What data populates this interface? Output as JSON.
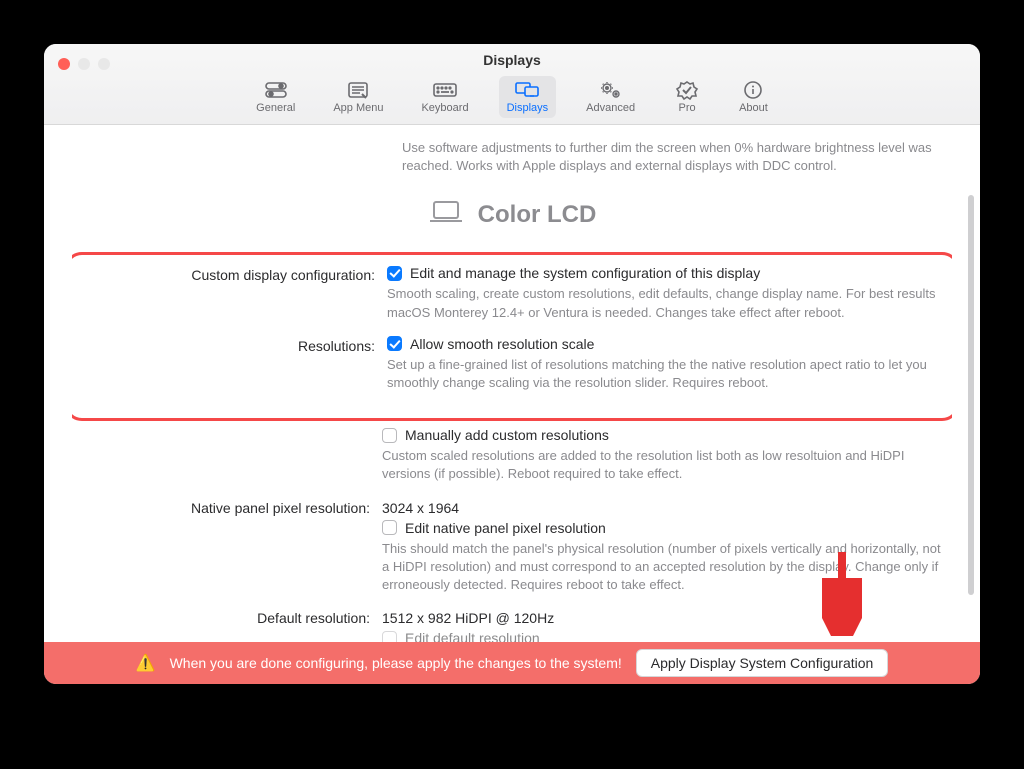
{
  "window": {
    "title": "Displays"
  },
  "toolbar": {
    "items": [
      {
        "key": "general",
        "label": "General"
      },
      {
        "key": "appmenu",
        "label": "App Menu"
      },
      {
        "key": "keyboard",
        "label": "Keyboard"
      },
      {
        "key": "displays",
        "label": "Displays"
      },
      {
        "key": "advanced",
        "label": "Advanced"
      },
      {
        "key": "pro",
        "label": "Pro"
      },
      {
        "key": "about",
        "label": "About"
      }
    ],
    "selected": "displays"
  },
  "intro": "Use software adjustments to further dim the screen when 0% hardware brightness level was reached. Works with Apple displays and external displays with DDC control.",
  "display_name": "Color LCD",
  "rows": {
    "custom_config": {
      "label": "Custom display configuration:",
      "checkbox_label": "Edit and manage the system configuration of this display",
      "checked": true,
      "desc": "Smooth scaling, create custom resolutions, edit defaults, change display name. For best results macOS Monterey 12.4+ or Ventura is needed. Changes take effect after reboot."
    },
    "resolutions": {
      "label": "Resolutions:",
      "checkbox_label": "Allow smooth resolution scale",
      "checked": true,
      "desc": "Set up a fine-grained list of resolutions matching the the native resolution apect ratio to let you smoothly change scaling via the resolution slider. Requires reboot."
    },
    "manual_add": {
      "checkbox_label": "Manually add custom resolutions",
      "checked": false,
      "desc": "Custom scaled resolutions are added to the resolution list both as low resoltuion and HiDPI versions (if possible). Reboot required to take effect."
    },
    "native_panel": {
      "label": "Native panel pixel resolution:",
      "value": "3024 x 1964"
    },
    "edit_native": {
      "checkbox_label": "Edit native panel pixel resolution",
      "checked": false,
      "desc": "This should match the panel's physical resolution (number of pixels vertically and horizontally, not a HiDPI resolution) and must correspond to an accepted resolution by the display. Change only if erroneously detected. Requires reboot to take effect."
    },
    "default_resolution": {
      "label": "Default resolution:",
      "value": "1512 x 982 HiDPI @ 120Hz"
    },
    "edit_default": {
      "checkbox_label": "Edit default resolution",
      "checked": false
    }
  },
  "footer": {
    "message": "When you are done configuring, please apply the changes to the system!",
    "button": "Apply Display System Configuration"
  },
  "colors": {
    "accent": "#0a7aff",
    "highlight_border": "#f54848",
    "footer_bg": "#f46e6a",
    "arrow": "#e52f2f"
  }
}
